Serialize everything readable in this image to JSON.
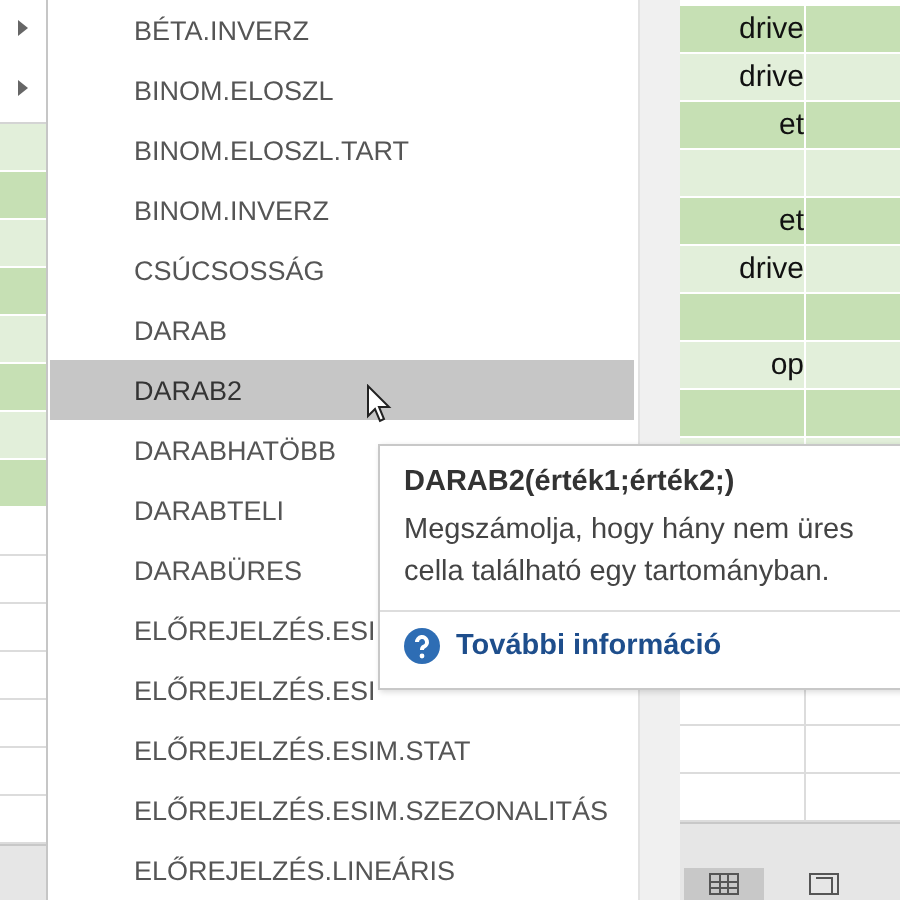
{
  "functions": [
    {
      "label": "BÉTA.INVERZ",
      "selected": false
    },
    {
      "label": "BINOM.ELOSZL",
      "selected": false
    },
    {
      "label": "BINOM.ELOSZL.TART",
      "selected": false
    },
    {
      "label": "BINOM.INVERZ",
      "selected": false
    },
    {
      "label": "CSÚCSOSSÁG",
      "selected": false
    },
    {
      "label": "DARAB",
      "selected": false
    },
    {
      "label": "DARAB2",
      "selected": true
    },
    {
      "label": "DARABHATÖBB",
      "selected": false
    },
    {
      "label": "DARABTELI",
      "selected": false
    },
    {
      "label": "DARABÜRES",
      "selected": false
    },
    {
      "label": "ELŐREJELZÉS.ESI",
      "selected": false
    },
    {
      "label": "ELŐREJELZÉS.ESI",
      "selected": false
    },
    {
      "label": "ELŐREJELZÉS.ESIM.STAT",
      "selected": false
    },
    {
      "label": "ELŐREJELZÉS.ESIM.SZEZONALITÁS",
      "selected": false
    },
    {
      "label": "ELŐREJELZÉS.LINEÁRIS",
      "selected": false
    }
  ],
  "sheet_rows": [
    {
      "column_1": "drive"
    },
    {
      "column_1": "drive"
    },
    {
      "column_1": "et"
    },
    {},
    {
      "column_1": "et"
    },
    {
      "column_1": "drive"
    },
    {},
    {
      "column_1": "op"
    },
    {},
    {}
  ],
  "tooltip": {
    "signature": "DARAB2(érték1;érték2;)",
    "description": "Megszámolja, hogy hány nem üres cella található egy tartományban.",
    "link": "További információ"
  }
}
